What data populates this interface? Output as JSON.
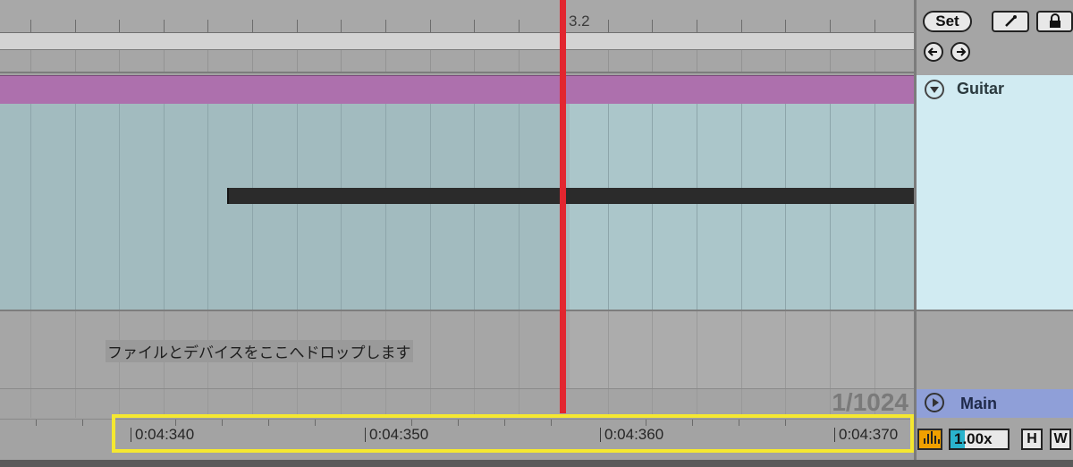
{
  "ruler": {
    "position_label": "3.2"
  },
  "toolbar": {
    "set_label": "Set",
    "draw_icon": "pencil-line-icon",
    "lock_icon": "lock-icon",
    "back_icon": "arrow-left-icon",
    "forward_icon": "arrow-right-icon"
  },
  "tracks": {
    "guitar": {
      "name": "Guitar",
      "color": "#d1ebf2",
      "clip_color": "#ad70ad"
    },
    "main": {
      "name": "Main",
      "color": "#8f9fd8"
    }
  },
  "drop_zone": {
    "text": "ファイルとデバイスをここへドロップします"
  },
  "grid": {
    "quantization": "1/1024"
  },
  "time_ruler": {
    "labels": [
      "0:04:340",
      "0:04:350",
      "0:04:360",
      "0:04:370"
    ]
  },
  "bottom_controls": {
    "follow_icon": "waveform-icon",
    "speed": "1.00x",
    "speed_fill_fraction": 0.25,
    "h_label": "H",
    "w_label": "W"
  },
  "colors": {
    "playhead": "#e2262f",
    "highlight": "#f5e830",
    "wave_button": "#f0a000",
    "speed_fill": "#2ab3cc"
  }
}
